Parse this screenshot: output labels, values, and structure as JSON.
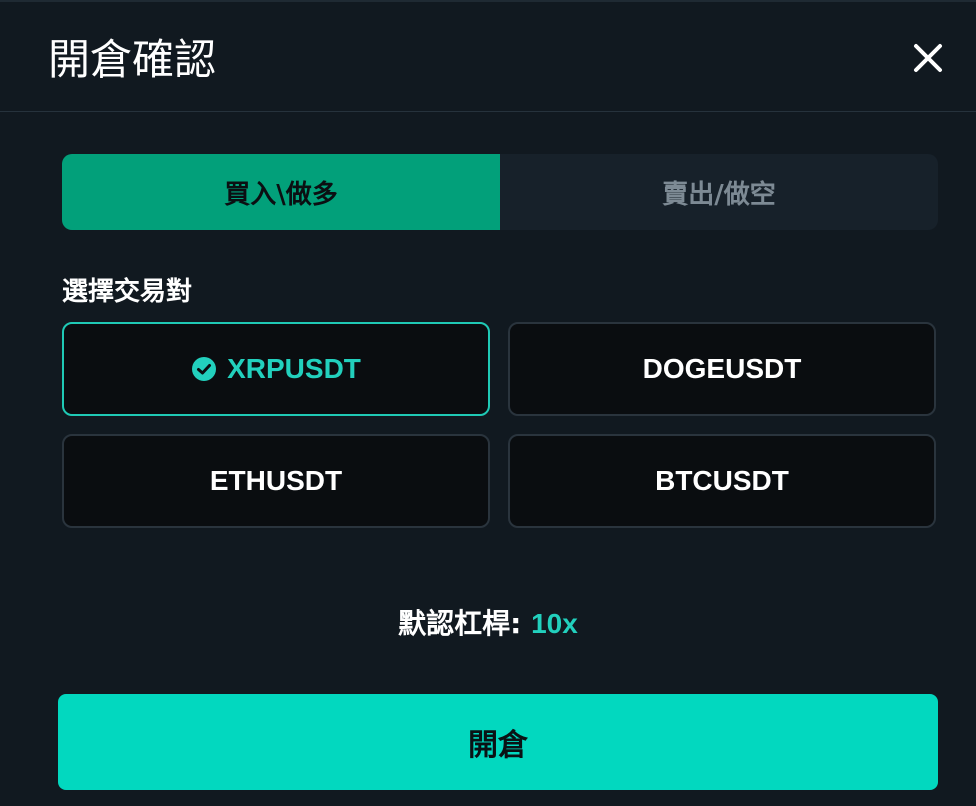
{
  "dialog": {
    "title": "開倉確認"
  },
  "side_tabs": [
    {
      "label": "買入\\做多",
      "active": true
    },
    {
      "label": "賣出/做空",
      "active": false
    }
  ],
  "pair_section": {
    "label": "選擇交易對",
    "pairs": [
      {
        "label": "XRPUSDT",
        "selected": true
      },
      {
        "label": "DOGEUSDT",
        "selected": false
      },
      {
        "label": "ETHUSDT",
        "selected": false
      },
      {
        "label": "BTCUSDT",
        "selected": false
      }
    ]
  },
  "leverage": {
    "label": "默認杠桿:",
    "value": "10x"
  },
  "open_button": {
    "label": "開倉"
  },
  "colors": {
    "background": "#111920",
    "buy_tab": "#02a07a",
    "accent": "#22d0bd",
    "primary_button": "#02d8bf"
  },
  "icons": {
    "close": "close-icon",
    "selected": "check-circle-icon"
  }
}
